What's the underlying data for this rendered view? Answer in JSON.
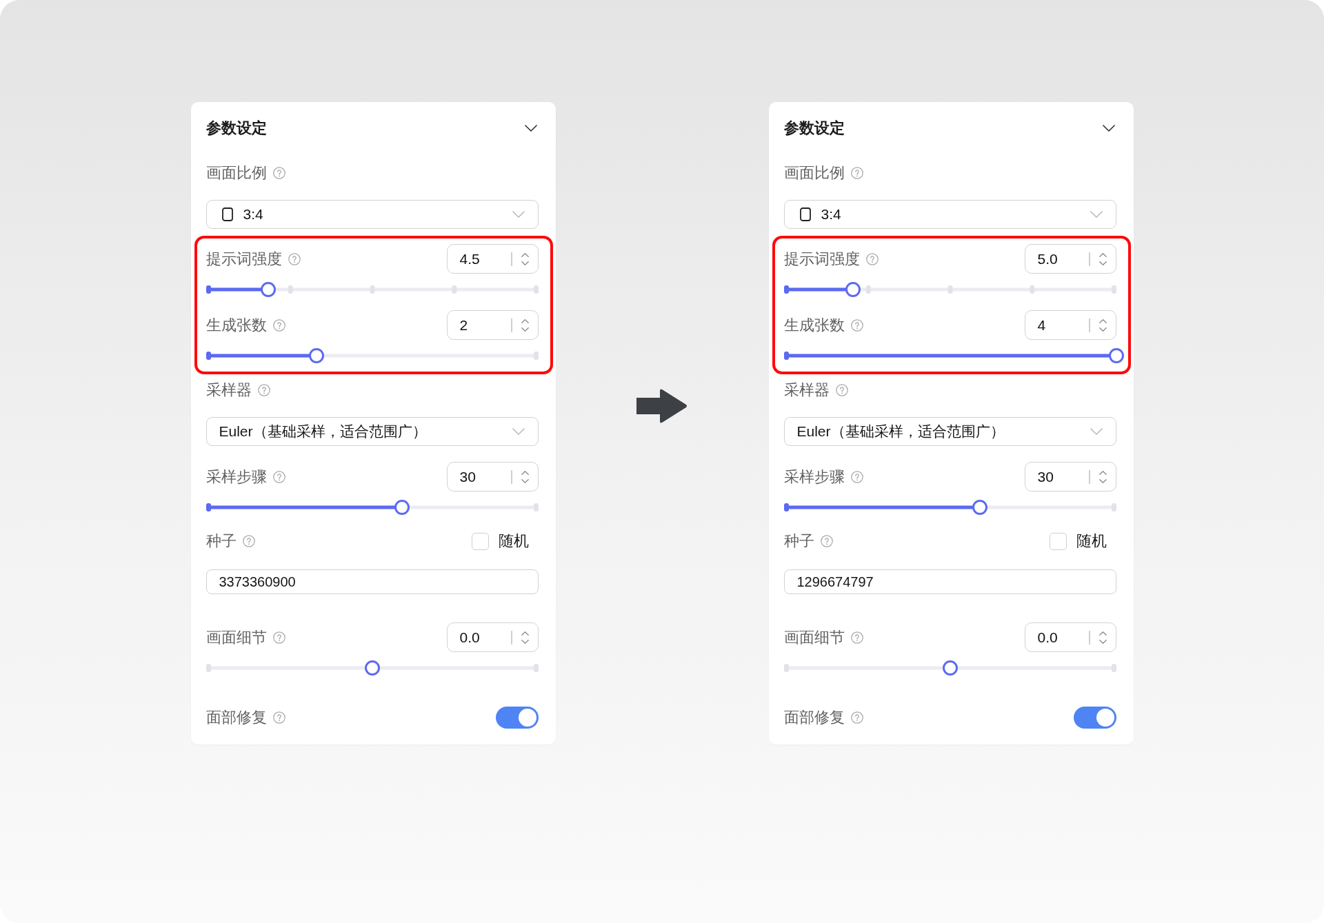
{
  "panels": [
    {
      "title": "参数设定",
      "fields": [
        {
          "kind": "ratio_select",
          "label": "画面比例",
          "value": "3:4",
          "highlighted": false
        },
        {
          "kind": "stepped_slider",
          "label": "提示词强度",
          "value": "4.5",
          "level": 0.187,
          "highlighted": true
        },
        {
          "kind": "slider",
          "label": "生成张数",
          "value": "2",
          "level": 0.333,
          "highlighted": true
        },
        {
          "kind": "select",
          "label": "采样器",
          "value": "Euler（基础采样，适合范围广）",
          "highlighted": false
        },
        {
          "kind": "slider",
          "label": "采样步骤",
          "value": "30",
          "level": 0.59,
          "highlighted": false
        },
        {
          "kind": "seed",
          "label": "种子",
          "checkbox_label": "随机",
          "checked": false,
          "value": "3373360900",
          "highlighted": false
        },
        {
          "kind": "centered_slider",
          "label": "画面细节",
          "value": "0.0",
          "level": 0.5,
          "highlighted": false
        },
        {
          "kind": "toggle",
          "label": "面部修复",
          "on": true,
          "highlighted": false
        }
      ]
    },
    {
      "title": "参数设定",
      "fields": [
        {
          "kind": "ratio_select",
          "label": "画面比例",
          "value": "3:4",
          "highlighted": false
        },
        {
          "kind": "stepped_slider",
          "label": "提示词强度",
          "value": "5.0",
          "level": 0.209,
          "highlighted": true
        },
        {
          "kind": "slider",
          "label": "生成张数",
          "value": "4",
          "level": 1,
          "highlighted": true
        },
        {
          "kind": "select",
          "label": "采样器",
          "value": "Euler（基础采样，适合范围广）",
          "highlighted": false
        },
        {
          "kind": "slider",
          "label": "采样步骤",
          "value": "30",
          "level": 0.59,
          "highlighted": false
        },
        {
          "kind": "seed",
          "label": "种子",
          "checkbox_label": "随机",
          "checked": false,
          "value": "1296674797",
          "highlighted": false
        },
        {
          "kind": "centered_slider",
          "label": "画面细节",
          "value": "0.0",
          "level": 0.5,
          "highlighted": false
        },
        {
          "kind": "toggle",
          "label": "面部修复",
          "on": true,
          "highlighted": false
        }
      ]
    }
  ]
}
